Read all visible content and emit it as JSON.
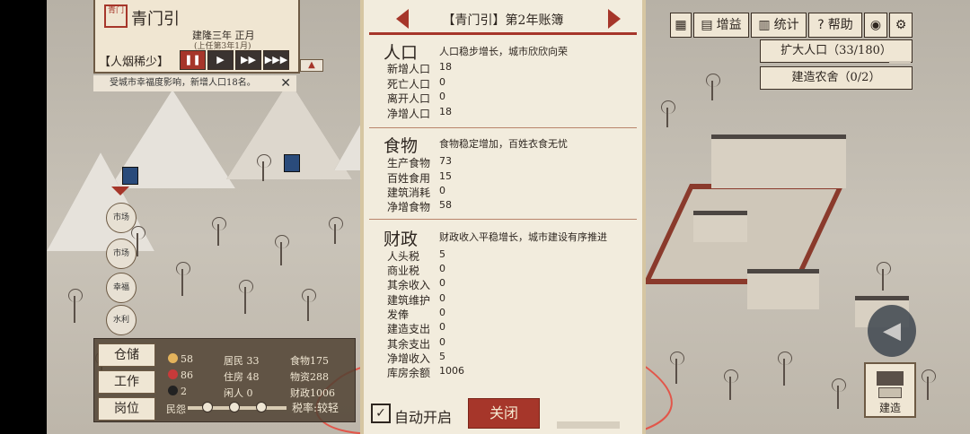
{
  "city_panel": {
    "seal": "青门",
    "city_name": "青门引",
    "era": "建隆三年 正月",
    "era_sub": "(上任第3年1月)",
    "status_tag": "【人烟稀少】",
    "speed_buttons": [
      "❚❚",
      "▶",
      "▶▶",
      "▶▶▶"
    ]
  },
  "notice": {
    "text": "受城市幸福度影响，新增人口18名。",
    "close": "✕"
  },
  "side_icons": [
    "市场",
    "市场",
    "幸福",
    "水利"
  ],
  "toolbar": {
    "book": "▦",
    "gain": "增益",
    "stats": "统计",
    "help": "帮助",
    "eye": "◉",
    "settings": "⚙"
  },
  "expand_population": "扩大人口（33/180）",
  "build_granary": "建造农舍（0/2）",
  "build_button": "建造",
  "stats_panel": {
    "buttons": [
      "仓储",
      "工作",
      "岗位"
    ],
    "people": "58",
    "hearts": "86",
    "hats": "2",
    "residents": "居民 33",
    "housing": "住房 48",
    "idle": "闲人 0",
    "food": "食物175",
    "materials": "物资288",
    "finance": "财政1006",
    "folk_label": "民怨",
    "tax_label": "税率:较轻"
  },
  "ledger": {
    "title": "【青门引】第2年账簿",
    "population": {
      "title": "人口",
      "desc": "人口稳步增长，城市欣欣向荣",
      "rows": [
        {
          "label": "新增人口",
          "value": "18"
        },
        {
          "label": "死亡人口",
          "value": "0"
        },
        {
          "label": "离开人口",
          "value": "0"
        },
        {
          "label": "净增人口",
          "value": "18"
        }
      ]
    },
    "food": {
      "title": "食物",
      "desc": "食物稳定增加，百姓衣食无忧",
      "rows": [
        {
          "label": "生产食物",
          "value": "73"
        },
        {
          "label": "百姓食用",
          "value": "15"
        },
        {
          "label": "建筑消耗",
          "value": "0"
        },
        {
          "label": "净增食物",
          "value": "58"
        }
      ]
    },
    "finance": {
      "title": "财政",
      "desc": "财政收入平稳增长，城市建设有序推进",
      "rows": [
        {
          "label": "人头税",
          "value": "5"
        },
        {
          "label": "商业税",
          "value": "0"
        },
        {
          "label": "其余收入",
          "value": "0"
        },
        {
          "label": "建筑维护",
          "value": "0"
        },
        {
          "label": "发俸",
          "value": "0"
        },
        {
          "label": "建造支出",
          "value": "0"
        },
        {
          "label": "其余支出",
          "value": "0"
        },
        {
          "label": "净增收入",
          "value": "5"
        },
        {
          "label": "库房余额",
          "value": "1006"
        }
      ]
    },
    "auto_open_label": "自动开启",
    "auto_open_checked": "✓",
    "close_label": "关闭"
  }
}
